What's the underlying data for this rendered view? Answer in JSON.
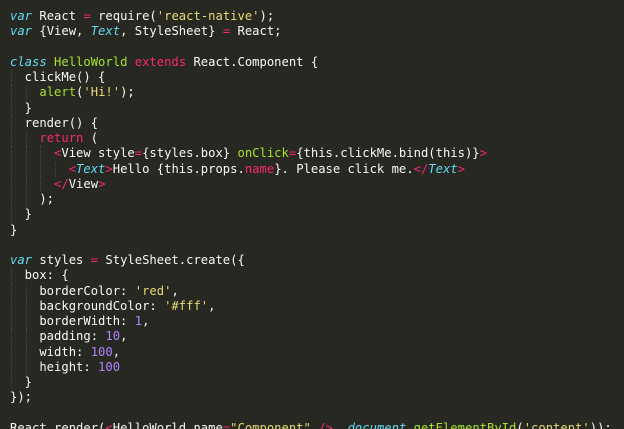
{
  "editor": {
    "lines": [
      {
        "tokens": [
          {
            "t": "var",
            "c": "kw-storage"
          },
          {
            "t": " React ",
            "c": "plain"
          },
          {
            "t": "=",
            "c": "kw"
          },
          {
            "t": " require(",
            "c": "plain"
          },
          {
            "t": "'react-native'",
            "c": "str"
          },
          {
            "t": ");",
            "c": "plain"
          }
        ]
      },
      {
        "tokens": [
          {
            "t": "var",
            "c": "kw-storage"
          },
          {
            "t": " {View, ",
            "c": "plain"
          },
          {
            "t": "Text",
            "c": "kw-storage"
          },
          {
            "t": ", StyleSheet} ",
            "c": "plain"
          },
          {
            "t": "=",
            "c": "kw"
          },
          {
            "t": " React;",
            "c": "plain"
          }
        ]
      },
      {
        "tokens": []
      },
      {
        "tokens": [
          {
            "t": "class",
            "c": "kw-storage"
          },
          {
            "t": " ",
            "c": "plain"
          },
          {
            "t": "HelloWorld",
            "c": "cls"
          },
          {
            "t": " ",
            "c": "plain"
          },
          {
            "t": "extends",
            "c": "kw"
          },
          {
            "t": " React.Component {",
            "c": "plain"
          }
        ]
      },
      {
        "indent": 1,
        "tokens": [
          {
            "t": "  clickMe() {",
            "c": "plain"
          }
        ]
      },
      {
        "indent": 2,
        "tokens": [
          {
            "t": "    ",
            "c": "plain"
          },
          {
            "t": "alert",
            "c": "fn"
          },
          {
            "t": "(",
            "c": "plain"
          },
          {
            "t": "'Hi!'",
            "c": "str"
          },
          {
            "t": ");",
            "c": "plain"
          }
        ]
      },
      {
        "indent": 1,
        "tokens": [
          {
            "t": "  }",
            "c": "plain"
          }
        ]
      },
      {
        "indent": 1,
        "tokens": [
          {
            "t": "  render() {",
            "c": "plain"
          }
        ]
      },
      {
        "indent": 2,
        "tokens": [
          {
            "t": "    ",
            "c": "plain"
          },
          {
            "t": "return",
            "c": "kw"
          },
          {
            "t": " (",
            "c": "plain"
          }
        ]
      },
      {
        "indent": 3,
        "tokens": [
          {
            "t": "      ",
            "c": "plain"
          },
          {
            "t": "<",
            "c": "tag"
          },
          {
            "t": "View style",
            "c": "plain"
          },
          {
            "t": "=",
            "c": "kw"
          },
          {
            "t": "{styles.box} ",
            "c": "plain"
          },
          {
            "t": "onClick",
            "c": "attr"
          },
          {
            "t": "=",
            "c": "kw"
          },
          {
            "t": "{this.clickMe.bind(this)}",
            "c": "plain"
          },
          {
            "t": ">",
            "c": "tag"
          }
        ]
      },
      {
        "indent": 4,
        "tokens": [
          {
            "t": "        ",
            "c": "plain"
          },
          {
            "t": "<",
            "c": "tag"
          },
          {
            "t": "Text",
            "c": "kw-storage"
          },
          {
            "t": ">",
            "c": "tag"
          },
          {
            "t": "Hello {this.props.",
            "c": "plain"
          },
          {
            "t": "name",
            "c": "tag"
          },
          {
            "t": "}. Please click me.",
            "c": "plain"
          },
          {
            "t": "</",
            "c": "tag"
          },
          {
            "t": "Text",
            "c": "kw-storage"
          },
          {
            "t": ">",
            "c": "tag"
          }
        ]
      },
      {
        "indent": 3,
        "tokens": [
          {
            "t": "      ",
            "c": "plain"
          },
          {
            "t": "</",
            "c": "tag"
          },
          {
            "t": "View",
            "c": "plain"
          },
          {
            "t": ">",
            "c": "tag"
          }
        ]
      },
      {
        "indent": 2,
        "tokens": [
          {
            "t": "    );",
            "c": "plain"
          }
        ]
      },
      {
        "indent": 1,
        "tokens": [
          {
            "t": "  }",
            "c": "plain"
          }
        ]
      },
      {
        "tokens": [
          {
            "t": "}",
            "c": "plain"
          }
        ]
      },
      {
        "tokens": []
      },
      {
        "tokens": [
          {
            "t": "var",
            "c": "kw-storage"
          },
          {
            "t": " styles ",
            "c": "plain"
          },
          {
            "t": "=",
            "c": "kw"
          },
          {
            "t": " StyleSheet.create({",
            "c": "plain"
          }
        ]
      },
      {
        "indent": 1,
        "tokens": [
          {
            "t": "  box: {",
            "c": "plain"
          }
        ]
      },
      {
        "indent": 2,
        "tokens": [
          {
            "t": "    borderColor: ",
            "c": "plain"
          },
          {
            "t": "'red'",
            "c": "str"
          },
          {
            "t": ",",
            "c": "plain"
          }
        ]
      },
      {
        "indent": 2,
        "tokens": [
          {
            "t": "    backgroundColor: ",
            "c": "plain"
          },
          {
            "t": "'#fff'",
            "c": "str"
          },
          {
            "t": ",",
            "c": "plain"
          }
        ]
      },
      {
        "indent": 2,
        "tokens": [
          {
            "t": "    borderWidth: ",
            "c": "plain"
          },
          {
            "t": "1",
            "c": "num"
          },
          {
            "t": ",",
            "c": "plain"
          }
        ]
      },
      {
        "indent": 2,
        "tokens": [
          {
            "t": "    padding: ",
            "c": "plain"
          },
          {
            "t": "10",
            "c": "num"
          },
          {
            "t": ",",
            "c": "plain"
          }
        ]
      },
      {
        "indent": 2,
        "tokens": [
          {
            "t": "    width: ",
            "c": "plain"
          },
          {
            "t": "100",
            "c": "num"
          },
          {
            "t": ",",
            "c": "plain"
          }
        ]
      },
      {
        "indent": 2,
        "tokens": [
          {
            "t": "    height: ",
            "c": "plain"
          },
          {
            "t": "100",
            "c": "num"
          }
        ]
      },
      {
        "indent": 1,
        "tokens": [
          {
            "t": "  }",
            "c": "plain"
          }
        ]
      },
      {
        "tokens": [
          {
            "t": "});",
            "c": "plain"
          }
        ]
      },
      {
        "tokens": []
      },
      {
        "tokens": [
          {
            "t": "React.render(",
            "c": "plain"
          },
          {
            "t": "<",
            "c": "tag"
          },
          {
            "t": "HelloWorld name",
            "c": "plain"
          },
          {
            "t": "=",
            "c": "kw"
          },
          {
            "t": "\"Component\"",
            "c": "str"
          },
          {
            "t": " ",
            "c": "plain"
          },
          {
            "t": "/>",
            "c": "tag"
          },
          {
            "t": ", ",
            "c": "plain"
          },
          {
            "t": "document",
            "c": "kw-storage"
          },
          {
            "t": ".",
            "c": "plain"
          },
          {
            "t": "getElementById",
            "c": "fn"
          },
          {
            "t": "(",
            "c": "plain"
          },
          {
            "t": "'content'",
            "c": "str"
          },
          {
            "t": "));",
            "c": "plain"
          }
        ]
      }
    ]
  }
}
